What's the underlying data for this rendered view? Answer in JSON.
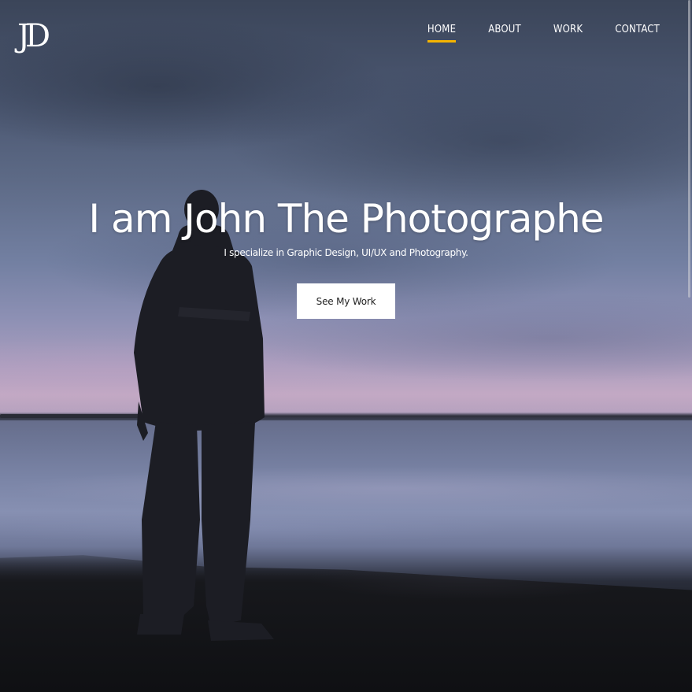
{
  "brand": {
    "logo_text": "JD"
  },
  "nav": {
    "items": [
      {
        "label": "HOME",
        "active": true
      },
      {
        "label": "ABOUT",
        "active": false
      },
      {
        "label": "WORK",
        "active": false
      },
      {
        "label": "CONTACT",
        "active": false
      }
    ],
    "active_color": "#f5b400"
  },
  "hero": {
    "title": "I am John The Photographe",
    "subtitle": "I specialize in Graphic Design, UI/UX and Photography.",
    "cta_label": "See My Work"
  },
  "background": {
    "image": "person-standing-at-lakeshore-dusk"
  }
}
